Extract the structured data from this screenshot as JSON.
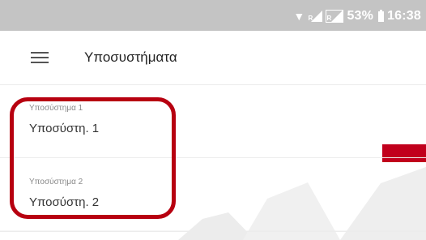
{
  "status_bar": {
    "network_marker": "R",
    "battery_percent": "53%",
    "time": "16:38",
    "icons": [
      "wifi-icon",
      "signal-icon",
      "signal-icon",
      "battery-icon"
    ]
  },
  "app_bar": {
    "menu_icon": "menu-icon",
    "title": "Υποσυστήματα"
  },
  "items": [
    {
      "caption": "Υποσύστημα 1",
      "value": "Υποσύστη. 1"
    },
    {
      "caption": "Υποσύστημα 2",
      "value": "Υποσύστη. 2"
    }
  ],
  "colors": {
    "status_bar_bg": "#c4c4c4",
    "annotation": "#b70010",
    "watermark_red": "#c1001c",
    "watermark_gray": "#e3e3e3"
  }
}
